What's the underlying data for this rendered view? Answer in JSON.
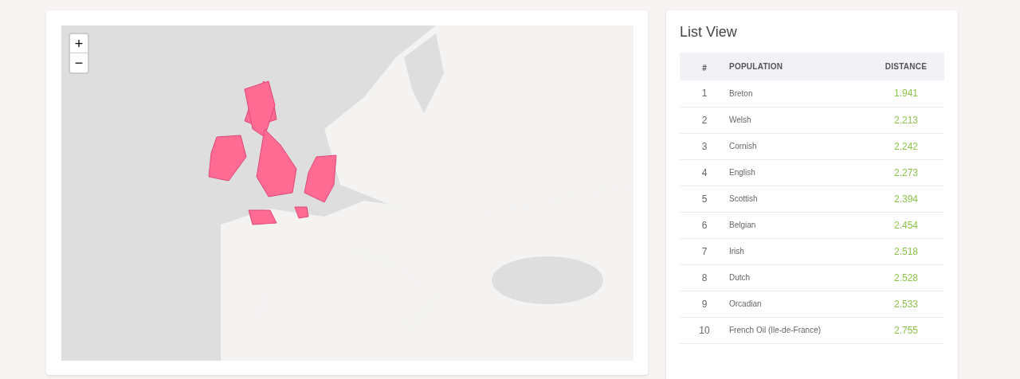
{
  "map": {
    "zoom_controls": [
      "+",
      "−"
    ]
  },
  "list_view": {
    "title": "List View",
    "columns": [
      "#",
      "POPULATION",
      "DISTANCE"
    ],
    "rows": [
      {
        "rank": "1",
        "population": "Breton",
        "distance": "1.941"
      },
      {
        "rank": "2",
        "population": "Welsh",
        "distance": "2.213"
      },
      {
        "rank": "3",
        "population": "Cornish",
        "distance": "2.242"
      },
      {
        "rank": "4",
        "population": "English",
        "distance": "2.273"
      },
      {
        "rank": "5",
        "population": "Scottish",
        "distance": "2.394"
      },
      {
        "rank": "6",
        "population": "Belgian",
        "distance": "2.454"
      },
      {
        "rank": "7",
        "population": "Irish",
        "distance": "2.518"
      },
      {
        "rank": "8",
        "population": "Dutch",
        "distance": "2.528"
      },
      {
        "rank": "9",
        "population": "Orcadian",
        "distance": "2.533"
      },
      {
        "rank": "10",
        "population": "French Oil (Ile-de-France)",
        "distance": "2.755"
      }
    ]
  }
}
